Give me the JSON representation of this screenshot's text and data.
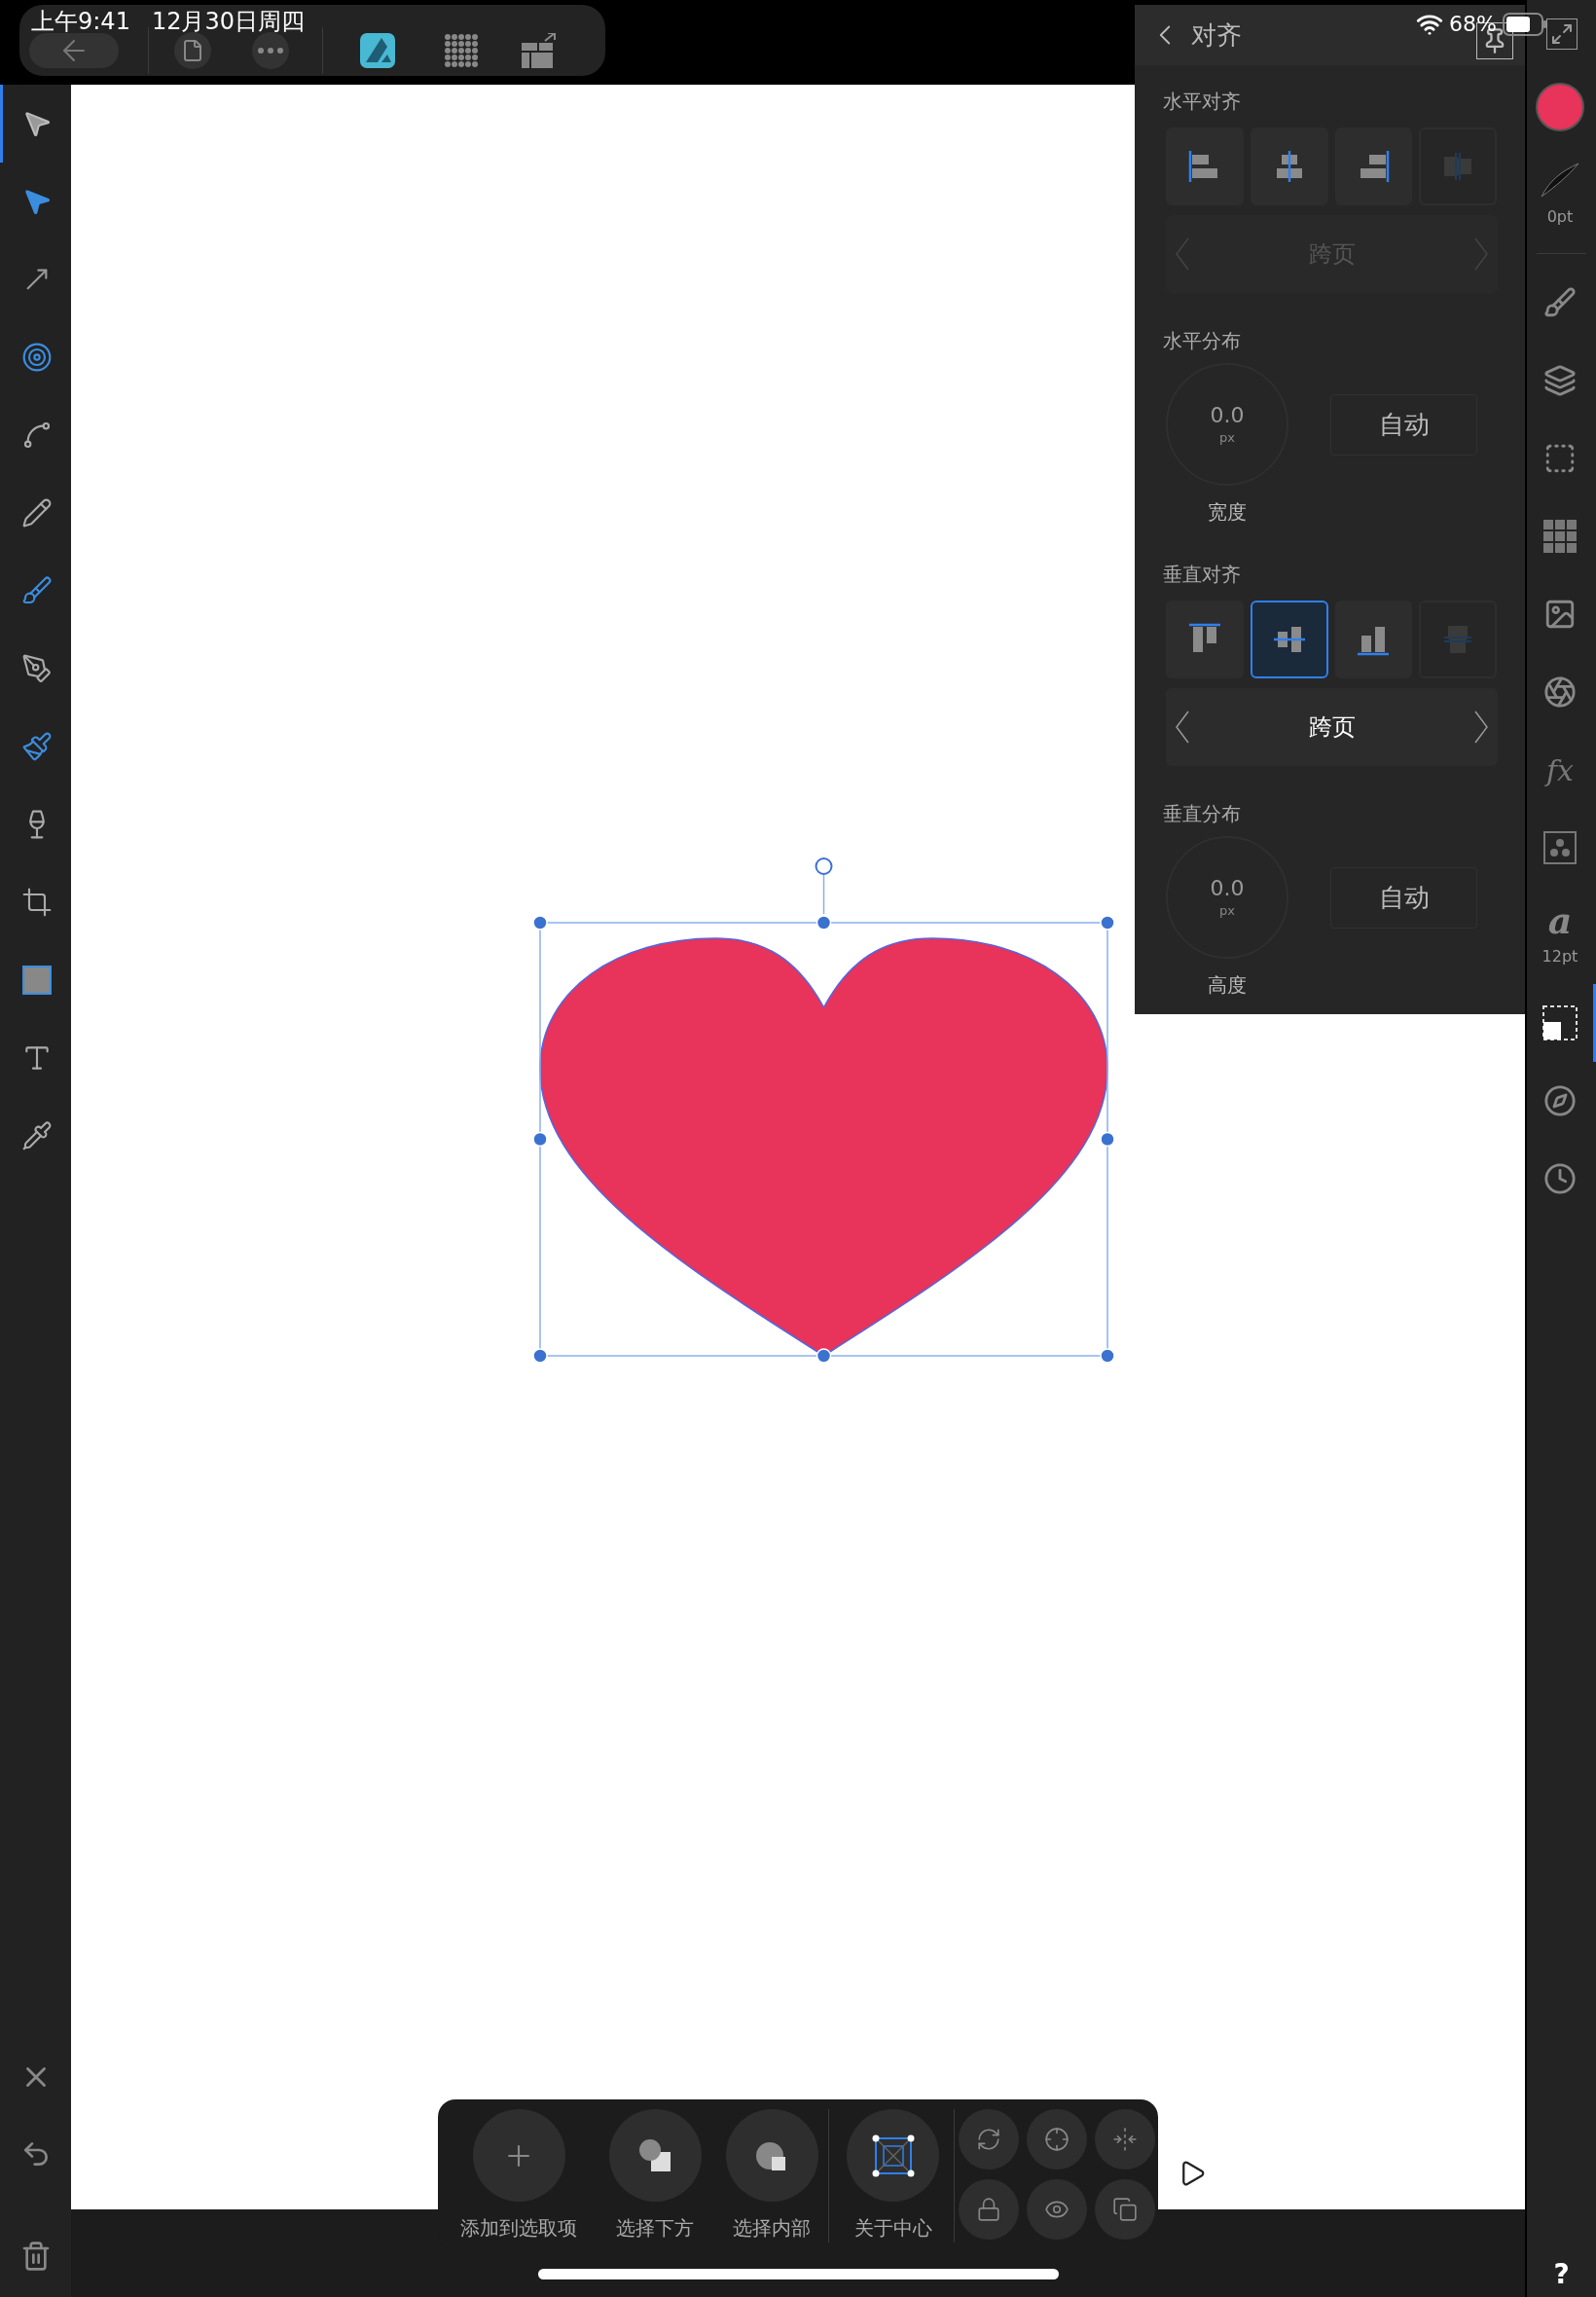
{
  "status_bar": {
    "time": "上午9:41",
    "date": "12月30日周四",
    "battery": "68%"
  },
  "tools": [
    {
      "kind": "move",
      "selected": true
    },
    {
      "kind": "node",
      "selected": false
    },
    {
      "kind": "corner",
      "selected": false
    },
    {
      "kind": "point_transform",
      "selected": false
    },
    {
      "kind": "contour",
      "selected": false
    },
    {
      "kind": "pencil",
      "selected": false
    },
    {
      "kind": "vector_brush",
      "selected": false
    },
    {
      "kind": "pen",
      "selected": false
    },
    {
      "kind": "fill",
      "selected": false
    },
    {
      "kind": "transparency",
      "selected": false
    },
    {
      "kind": "crop",
      "selected": false
    },
    {
      "kind": "shape",
      "selected": false
    },
    {
      "kind": "text",
      "selected": false
    },
    {
      "kind": "picker",
      "selected": false
    }
  ],
  "studio": [
    {
      "kind": "fill",
      "selected": false
    },
    {
      "kind": "stroke",
      "label": "0pt",
      "selected": false
    },
    {
      "kind": "brushes",
      "selected": false
    },
    {
      "kind": "layers",
      "selected": false
    },
    {
      "kind": "effects",
      "selected": false
    },
    {
      "kind": "swatches",
      "selected": false
    },
    {
      "kind": "assets",
      "selected": false
    },
    {
      "kind": "appearance",
      "selected": false
    },
    {
      "kind": "fx",
      "glyph": "fx",
      "selected": false
    },
    {
      "kind": "symbols",
      "selected": false
    },
    {
      "kind": "text_styles",
      "glyph": "a",
      "label": "12pt",
      "selected": false
    },
    {
      "kind": "transform",
      "selected": true
    },
    {
      "kind": "navigator",
      "selected": false
    },
    {
      "kind": "history",
      "selected": false
    }
  ],
  "panel": {
    "title": "对齐",
    "sections": [
      {
        "kind": "align",
        "label": "水平对齐",
        "buttons": [
          {
            "kind": "left",
            "selected": false,
            "disabled": false
          },
          {
            "kind": "hcenter",
            "selected": false,
            "disabled": false
          },
          {
            "kind": "right",
            "selected": false,
            "disabled": false
          },
          {
            "kind": "hspread",
            "selected": false,
            "disabled": true
          }
        ],
        "span": {
          "value": "跨页",
          "disabled": true
        }
      },
      {
        "kind": "distribute",
        "label": "水平分布",
        "value": "0.0",
        "unit": "px",
        "caption": "宽度",
        "mode": "自动"
      },
      {
        "kind": "align",
        "label": "垂直对齐",
        "buttons": [
          {
            "kind": "top",
            "selected": false,
            "disabled": false
          },
          {
            "kind": "vcenter",
            "selected": true,
            "disabled": false
          },
          {
            "kind": "bottom",
            "selected": false,
            "disabled": false
          },
          {
            "kind": "vspread",
            "selected": false,
            "disabled": true
          }
        ],
        "span": {
          "value": "跨页",
          "disabled": false
        }
      },
      {
        "kind": "distribute",
        "label": "垂直分布",
        "value": "0.0",
        "unit": "px",
        "caption": "高度",
        "mode": "自动"
      }
    ]
  },
  "context_bar": {
    "actions": [
      {
        "kind": "add",
        "label": "添加到选取项"
      },
      {
        "kind": "below",
        "label": "选择下方"
      },
      {
        "kind": "inside",
        "label": "选择内部"
      },
      {
        "kind": "center",
        "label": "关于中心"
      }
    ]
  },
  "help": "?"
}
